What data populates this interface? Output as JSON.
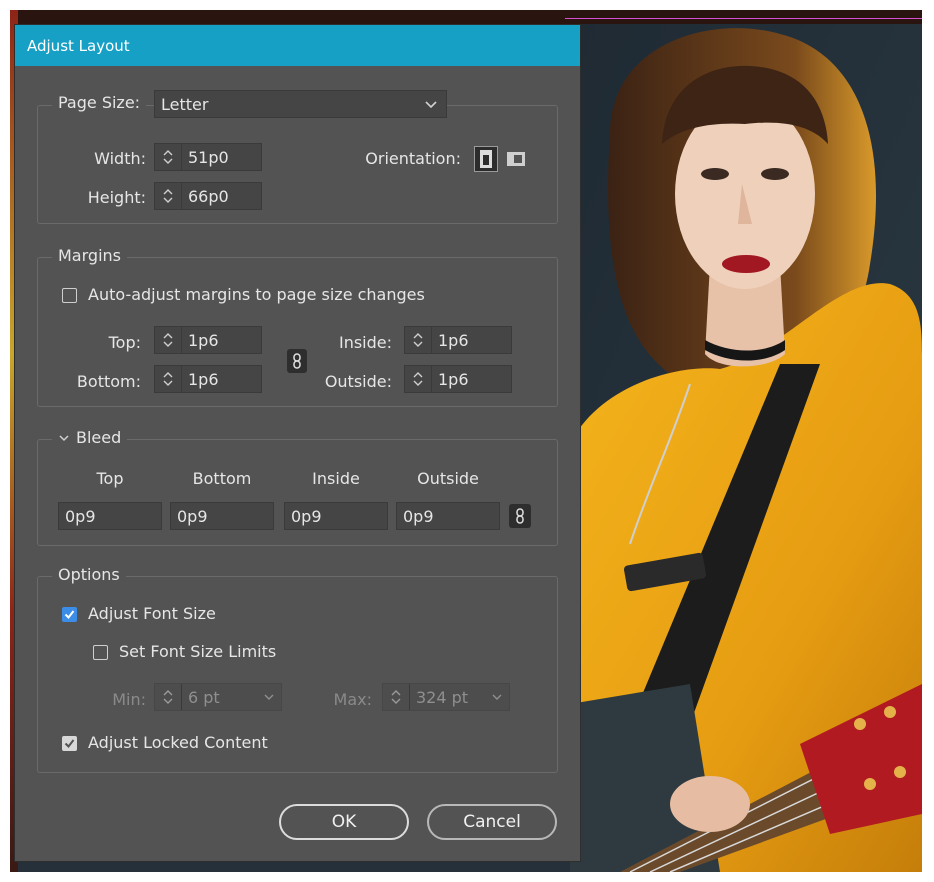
{
  "dialog": {
    "title": "Adjust Layout",
    "page_size": {
      "label": "Page Size:",
      "value": "Letter",
      "width_label": "Width:",
      "width_value": "51p0",
      "height_label": "Height:",
      "height_value": "66p0",
      "orientation_label": "Orientation:"
    },
    "margins": {
      "legend": "Margins",
      "auto_adjust_label": "Auto-adjust margins to page size changes",
      "auto_adjust_checked": false,
      "top_label": "Top:",
      "top_value": "1p6",
      "bottom_label": "Bottom:",
      "bottom_value": "1p6",
      "inside_label": "Inside:",
      "inside_value": "1p6",
      "outside_label": "Outside:",
      "outside_value": "1p6"
    },
    "bleed": {
      "legend": "Bleed",
      "columns": [
        "Top",
        "Bottom",
        "Inside",
        "Outside"
      ],
      "values": [
        "0p9",
        "0p9",
        "0p9",
        "0p9"
      ]
    },
    "options": {
      "legend": "Options",
      "adjust_font_size_label": "Adjust Font Size",
      "adjust_font_size_checked": true,
      "set_font_size_limits_label": "Set Font Size Limits",
      "set_font_size_limits_checked": false,
      "min_label": "Min:",
      "min_value": "6 pt",
      "max_label": "Max:",
      "max_value": "324 pt",
      "adjust_locked_content_label": "Adjust Locked Content",
      "adjust_locked_content_checked": true
    },
    "buttons": {
      "ok": "OK",
      "cancel": "Cancel"
    }
  },
  "colors": {
    "titlebar": "#16a0c6",
    "dialog_bg": "#535353",
    "checkbox_accent": "#3c8de8",
    "guide": "#d64fd3"
  },
  "icons": [
    "chevron-down-icon",
    "spinner-arrows-icon",
    "portrait-orientation-icon",
    "landscape-orientation-icon",
    "chain-link-icon",
    "checkmark-icon"
  ]
}
